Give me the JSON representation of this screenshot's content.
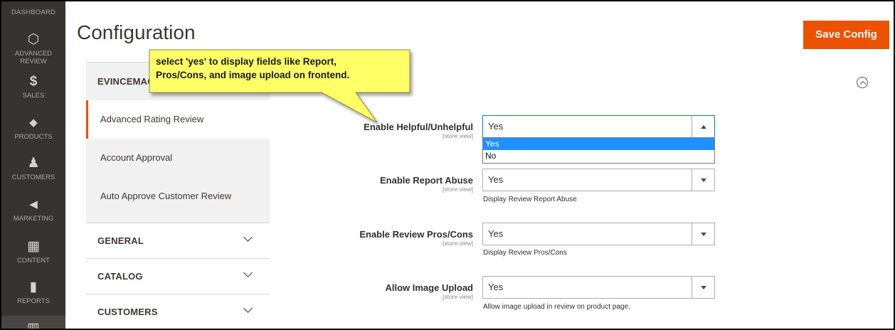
{
  "sidebar": {
    "top_label": "DASHBOARD",
    "items": [
      {
        "icon": "hexagon-icon",
        "glyph": "⬡",
        "label": "ADVANCED REVIEW"
      },
      {
        "icon": "dollar-icon",
        "glyph": "$",
        "label": "SALES"
      },
      {
        "icon": "box-icon",
        "glyph": "◆",
        "label": "PRODUCTS"
      },
      {
        "icon": "person-icon",
        "glyph": "♟",
        "label": "CUSTOMERS"
      },
      {
        "icon": "megaphone-icon",
        "glyph": "◀",
        "label": "MARKETING"
      },
      {
        "icon": "layout-icon",
        "glyph": "▦",
        "label": "CONTENT"
      },
      {
        "icon": "bar-chart-icon",
        "glyph": "▮",
        "label": "REPORTS"
      },
      {
        "icon": "store-icon",
        "glyph": "▥",
        "label": ""
      }
    ]
  },
  "header": {
    "title": "Configuration",
    "save_label": "Save Config"
  },
  "tabs": {
    "groups": [
      {
        "title": "EVINCEMAG",
        "expanded": true,
        "items": [
          "Advanced Rating Review",
          "Account Approval",
          "Auto Approve Customer Review"
        ]
      },
      {
        "title": "GENERAL"
      },
      {
        "title": "CATALOG"
      },
      {
        "title": "CUSTOMERS"
      }
    ]
  },
  "callout": {
    "line1": "select 'yes' to display fields like Report,",
    "line2": "Pros/Cons, and image upload on frontend."
  },
  "form": {
    "fields": [
      {
        "label": "Enable Helpful/Unhelpful",
        "scope": "[store view]",
        "value": "Yes",
        "note": "",
        "open": true
      },
      {
        "label": "Enable Report Abuse",
        "scope": "[store view]",
        "value": "Yes",
        "note": "Display Review Report Abuse"
      },
      {
        "label": "Enable Review Pros/Cons",
        "scope": "[store view]",
        "value": "Yes",
        "note": "Display Review Pros/Cons"
      },
      {
        "label": "Allow Image Upload",
        "scope": "[store view]",
        "value": "Yes",
        "note": "Allow image upload in review on product page."
      }
    ],
    "dropdown_options": [
      "Yes",
      "No"
    ],
    "dropdown_selected": "Yes"
  },
  "colors": {
    "accent": "#eb5202",
    "sidebar_bg": "#373330",
    "callout_fill": "#ffff66",
    "selected_option": "#1e90ff"
  }
}
